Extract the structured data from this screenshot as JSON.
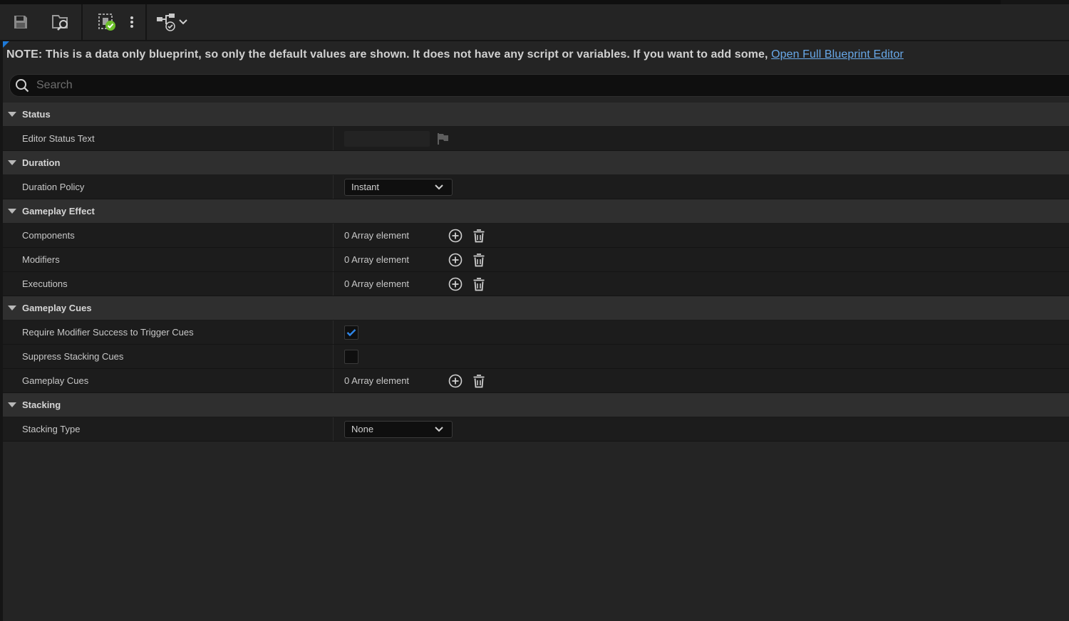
{
  "toolbar": {
    "icons": [
      "save-icon",
      "browse-icon",
      "compile-icon",
      "more-options-icon",
      "diff-icon",
      "chevron-down-icon"
    ]
  },
  "note": {
    "text": "NOTE: This is a data only blueprint, so only the default values are shown.  It does not have any script or variables.  If you want to add some,",
    "link": "Open Full Blueprint Editor"
  },
  "search": {
    "placeholder": "Search"
  },
  "categories": {
    "status": {
      "title": "Status",
      "editor_status_text": {
        "label": "Editor Status Text",
        "value": ""
      }
    },
    "duration": {
      "title": "Duration",
      "duration_policy": {
        "label": "Duration Policy",
        "value": "Instant"
      }
    },
    "gameplay_effect": {
      "title": "Gameplay Effect",
      "components": {
        "label": "Components",
        "value": "0 Array element"
      },
      "modifiers": {
        "label": "Modifiers",
        "value": "0 Array element"
      },
      "executions": {
        "label": "Executions",
        "value": "0 Array element"
      }
    },
    "gameplay_cues": {
      "title": "Gameplay Cues",
      "require_modifier_success": {
        "label": "Require Modifier Success to Trigger Cues",
        "checked": true
      },
      "suppress_stacking_cues": {
        "label": "Suppress Stacking Cues",
        "checked": false
      },
      "gameplay_cues": {
        "label": "Gameplay Cues",
        "value": "0 Array element"
      }
    },
    "stacking": {
      "title": "Stacking",
      "stacking_type": {
        "label": "Stacking Type",
        "value": "None"
      }
    }
  },
  "colors": {
    "accent": "#1e7ad9",
    "link": "#68a8e8",
    "check": "#2f86e8",
    "compile_ok": "#6cbf2a"
  }
}
